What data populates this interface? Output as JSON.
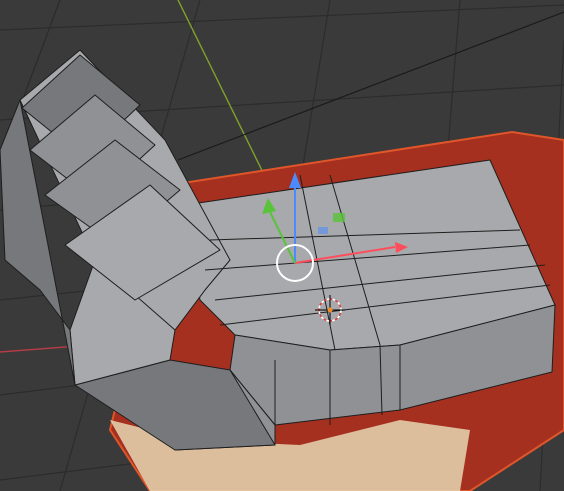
{
  "viewport": {
    "background_color": "#3a3a3a",
    "grid_color": "#2c2c2c",
    "x_axis_color": "#b43c46",
    "y_axis_color": "#7fa32a",
    "icons": {
      "gizmo": "transform-gizmo-icon",
      "cursor": "3d-cursor-icon",
      "origin": "object-origin-icon"
    }
  },
  "gizmo": {
    "x_color": "#ff4d5b",
    "y_color": "#59c43a",
    "z_color": "#4a8cff",
    "ring_color": "#ffffff"
  },
  "mesh": {
    "face_light": "#a7a9ac",
    "face_mid": "#8f9194",
    "face_dark": "#76787b",
    "edge_color": "#1e1e1e"
  },
  "reference_image": {
    "color": "#a5301f",
    "outline": "#e0562a",
    "light_color": "#e6d7b3"
  }
}
